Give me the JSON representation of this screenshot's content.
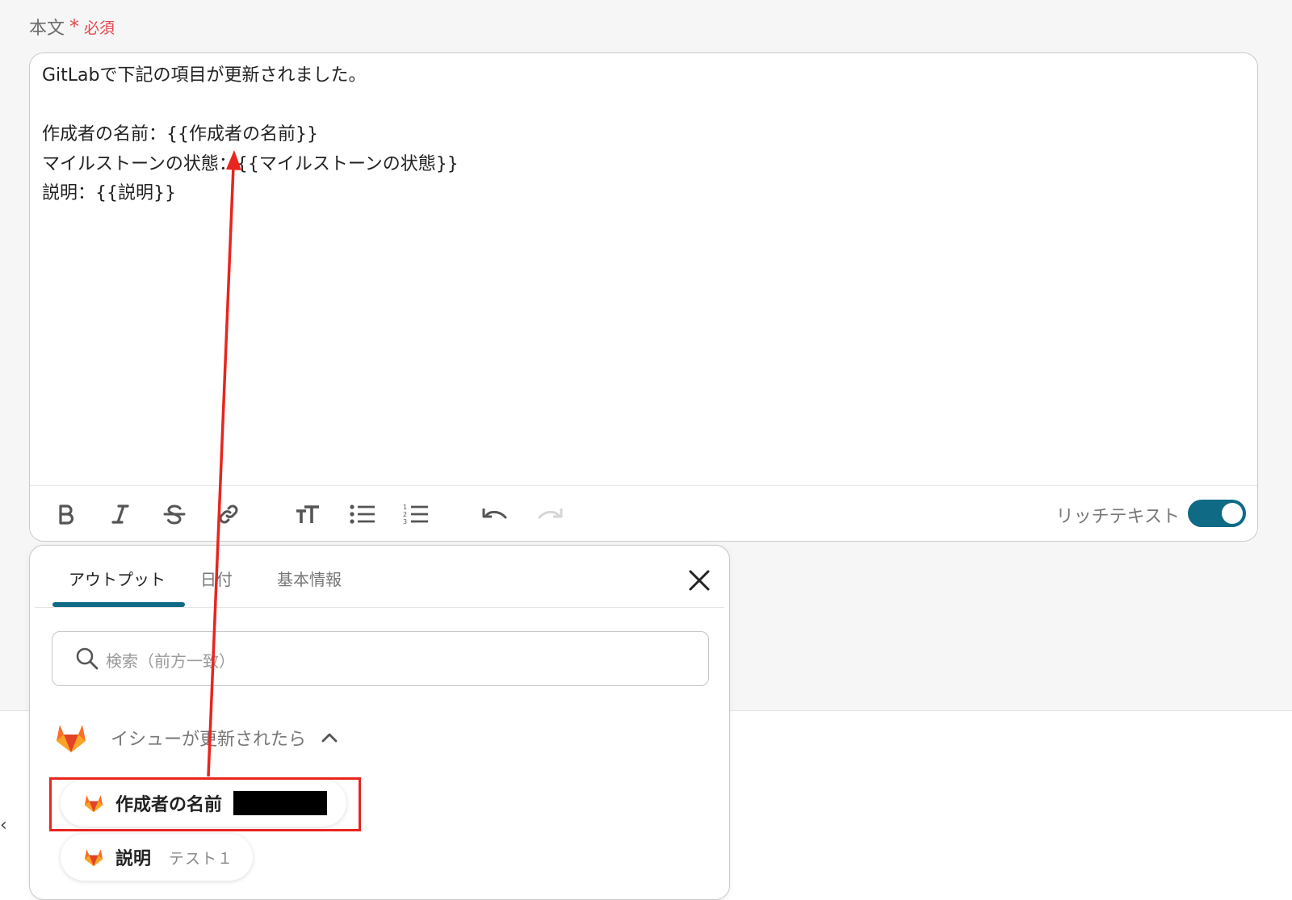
{
  "field": {
    "label": "本文",
    "required_star": "*",
    "required_text": "必須"
  },
  "editor": {
    "lines": [
      "GitLabで下記の項目が更新されました。",
      "",
      "作成者の名前：{{作成者の名前}}",
      "マイルストーンの状態：{{マイルストーンの状態}}",
      "説明：{{説明}}"
    ],
    "toolbar": {
      "buttons": [
        "bold-icon",
        "italic-icon",
        "strikethrough-icon",
        "link-icon",
        "text-size-icon",
        "bullet-list-icon",
        "numbered-list-icon",
        "undo-icon",
        "redo-icon"
      ],
      "rich_text_label": "リッチテキスト",
      "rich_text_enabled": true
    }
  },
  "popup": {
    "tabs": [
      {
        "label": "アウトプット",
        "active": true
      },
      {
        "label": "日付",
        "active": false
      },
      {
        "label": "基本情報",
        "active": false
      }
    ],
    "search_placeholder": "検索（前方一致）",
    "group": {
      "label": "イシューが更新されたら",
      "icon": "gitlab-icon",
      "expanded": true
    },
    "items": [
      {
        "name": "作成者の名前",
        "value_redacted": true,
        "highlighted": true
      },
      {
        "name": "説明",
        "value": "テスト１"
      }
    ]
  },
  "colors": {
    "accent": "#0e6a85",
    "required": "#e5484d",
    "annotation": "#e8251e"
  }
}
